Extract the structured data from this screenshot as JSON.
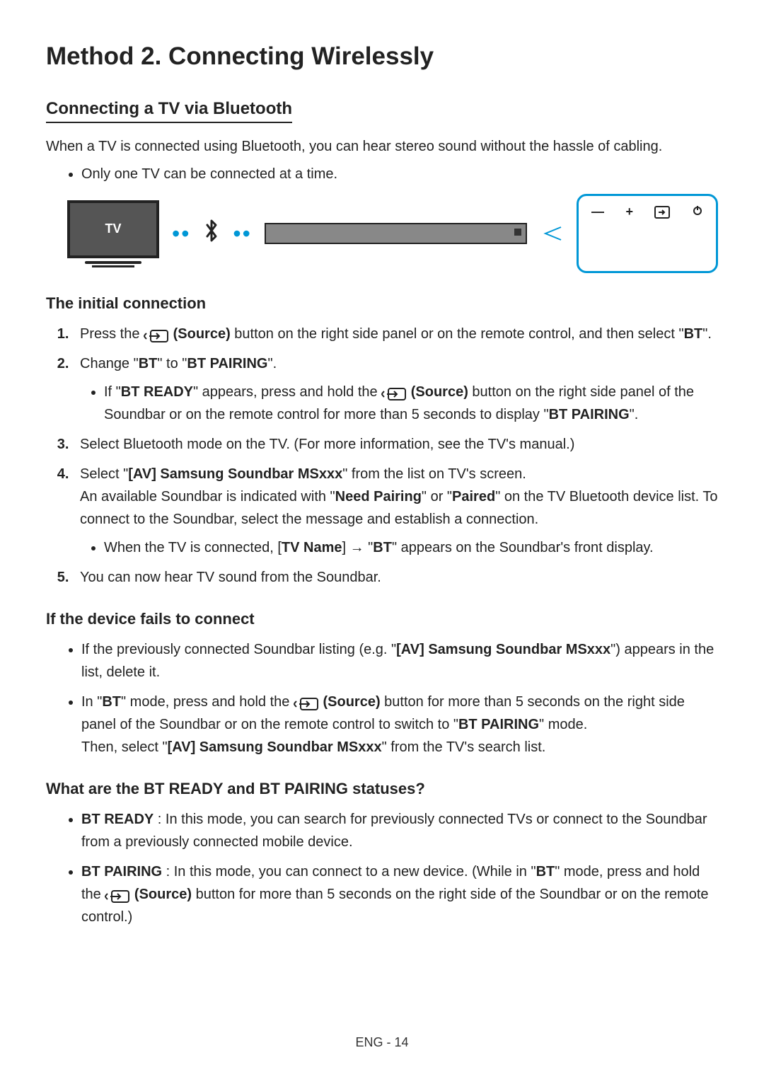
{
  "title": "Method 2. Connecting Wirelessly",
  "section_heading": "Connecting a TV via Bluetooth",
  "intro": "When a TV is connected using Bluetooth, you can hear stereo sound without the hassle of cabling.",
  "note_one_tv": "Only one TV can be connected at a time.",
  "diagram": {
    "tv_label": "TV"
  },
  "h_initial": "The initial connection",
  "steps": {
    "s1_a": "Press the ",
    "s1_source": "(Source)",
    "s1_b": " button on the right side panel or on the remote control, and then select \"",
    "s1_bt": "BT",
    "s1_c": "\".",
    "s2_a": "Change \"",
    "s2_bt": "BT",
    "s2_b": "\" to \"",
    "s2_btp": "BT PAIRING",
    "s2_c": "\".",
    "s2_sub_a": "If \"",
    "s2_sub_ready": "BT READY",
    "s2_sub_b": "\" appears, press and hold the ",
    "s2_sub_source": "(Source)",
    "s2_sub_c": " button on the right side panel of the Soundbar or on the remote control for more than 5 seconds to display \"",
    "s2_sub_btp": "BT PAIRING",
    "s2_sub_d": "\".",
    "s3": "Select Bluetooth mode on the TV. (For more information, see the TV's manual.)",
    "s4_a": "Select \"",
    "s4_name": "[AV] Samsung Soundbar MSxxx",
    "s4_b": "\" from the list on TV's screen.",
    "s4_line2_a": "An available Soundbar is indicated with \"",
    "s4_need": "Need Pairing",
    "s4_line2_b": "\" or \"",
    "s4_paired": "Paired",
    "s4_line2_c": "\" on the TV Bluetooth device list. To connect to the Soundbar, select the message and establish a connection.",
    "s4_sub_a": "When the TV is connected, [",
    "s4_sub_tvname": "TV Name",
    "s4_sub_b": "] → \"",
    "s4_sub_bt": "BT",
    "s4_sub_c": "\" appears on the Soundbar's front display.",
    "s5": "You can now hear TV sound from the Soundbar."
  },
  "h_fail": "If the device fails to connect",
  "fail": {
    "b1_a": "If the previously connected Soundbar listing (e.g. \"",
    "b1_name": "[AV] Samsung Soundbar MSxxx",
    "b1_b": "\") appears in the list, delete it.",
    "b2_a": "In \"",
    "b2_bt": "BT",
    "b2_b": "\" mode, press and hold the ",
    "b2_source": "(Source)",
    "b2_c": " button for more than 5 seconds on the right side panel of the Soundbar or on the remote control to switch to \"",
    "b2_btp": "BT PAIRING",
    "b2_d": "\" mode.",
    "b2_line2_a": "Then, select \"",
    "b2_line2_name": "[AV] Samsung Soundbar MSxxx",
    "b2_line2_b": "\" from the TV's search list."
  },
  "h_status": "What are the BT READY and BT PAIRING statuses?",
  "status": {
    "ready_label": "BT READY",
    "ready_text": " : In this mode, you can search for previously connected TVs or connect to the Soundbar from a previously connected mobile device.",
    "pairing_label": "BT PAIRING",
    "pairing_a": " : In this mode, you can connect to a new device. (While in \"",
    "pairing_bt": "BT",
    "pairing_b": "\" mode, press and hold the ",
    "pairing_source": "(Source)",
    "pairing_c": " button for more than 5 seconds on the right side of the Soundbar or on the remote control.)"
  },
  "footer": "ENG - 14"
}
